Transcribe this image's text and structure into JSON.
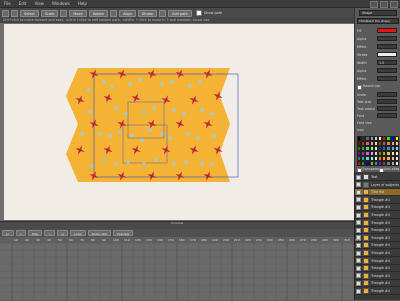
{
  "menu": [
    "File",
    "Edit",
    "View",
    "Windows",
    "Help"
  ],
  "toolbar": {
    "buttons": [
      "Select",
      "Scale",
      "Move",
      "Rotate",
      "Align",
      "Stroke",
      "Add path"
    ],
    "checkbox_label": "Show path"
  },
  "hint": "Ctrl+click to move forward and back, <ctrl>+click to edit bottom path, <shift> + click to move in 3 and maintain visual size",
  "timeline": {
    "title": "Timeline",
    "controls": [
      "|<",
      "<",
      "Play",
      ">",
      ">|",
      "Loop",
      "Onion skin",
      "Preview"
    ],
    "ticks": [
      "10",
      "20",
      "30",
      "40",
      "50",
      "60",
      "70",
      "80",
      "90",
      "100",
      "110",
      "120",
      "130",
      "140",
      "150",
      "160",
      "170",
      "180",
      "190",
      "200",
      "210",
      "220",
      "230",
      "240",
      "250",
      "260",
      "270",
      "280",
      "290",
      "300",
      "310",
      "320"
    ]
  },
  "right_panel": {
    "shape_dropdown": "Shape",
    "name_value": "TRIANGLE the shape",
    "labels": [
      "Fill",
      "Alpha",
      "Effect",
      "Stroke",
      "Width",
      "Alpha",
      "Effect"
    ],
    "width_value": "1.5",
    "rounded_label": "Round cap",
    "labels2": [
      "Scale",
      "Text size",
      "Text colour",
      "Font",
      "Font size",
      "Icon"
    ],
    "colors": {
      "fill": "#ee1111",
      "stroke": "#eeeeee"
    },
    "checkboxes": [
      "Transparent",
      "Anti-alias"
    ]
  },
  "layers": [
    {
      "name": "Text",
      "color": "#dddddd"
    },
    {
      "name": "Layer of subjects",
      "color": "#777777"
    },
    {
      "name": "Title fist",
      "color": "#f0b040",
      "selected": true
    },
    {
      "name": "Triangle #4",
      "color": "#f0b040"
    },
    {
      "name": "Triangle #4",
      "color": "#f0b040"
    },
    {
      "name": "Triangle #4",
      "color": "#f0b040"
    },
    {
      "name": "Triangle #4",
      "color": "#f0b040"
    },
    {
      "name": "Triangle #4",
      "color": "#f0b040"
    },
    {
      "name": "Triangle #4",
      "color": "#f0b040"
    },
    {
      "name": "Triangle #4",
      "color": "#f0b040"
    },
    {
      "name": "Triangle #4",
      "color": "#f0b040"
    },
    {
      "name": "Triangle #4",
      "color": "#f0b040"
    },
    {
      "name": "Triangle #4",
      "color": "#f0b040"
    },
    {
      "name": "Triangle #4",
      "color": "#f0b040"
    },
    {
      "name": "Triangle #4",
      "color": "#f0b040"
    },
    {
      "name": "Triangle #4",
      "color": "#f0b040"
    }
  ],
  "palette": [
    "#000",
    "#333",
    "#666",
    "#999",
    "#ccc",
    "#fff",
    "#f00",
    "#0f0",
    "#00f",
    "#ff0",
    "#800",
    "#a33",
    "#c66",
    "#e99",
    "#fcc",
    "#840",
    "#a62",
    "#c84",
    "#ea6",
    "#fc8",
    "#080",
    "#3a3",
    "#6c6",
    "#9e9",
    "#cfc",
    "#048",
    "#26a",
    "#48c",
    "#6ae",
    "#8cf",
    "#808",
    "#a3a",
    "#c6c",
    "#e9e",
    "#fcf",
    "#880",
    "#aa3",
    "#cc6",
    "#ee9",
    "#ffc",
    "#088",
    "#3aa",
    "#6cc",
    "#9ee",
    "#cff",
    "#f80",
    "#f93",
    "#fa6",
    "#fb9",
    "#fdc",
    "#d00",
    "#0a0",
    "#00a",
    "#aa0",
    "#0aa",
    "#a0a",
    "#555",
    "#777",
    "#aaa",
    "#eee"
  ],
  "pattern": {
    "fill": "#f5b335",
    "star": "#c0283a",
    "dot": "#8ecff0"
  }
}
